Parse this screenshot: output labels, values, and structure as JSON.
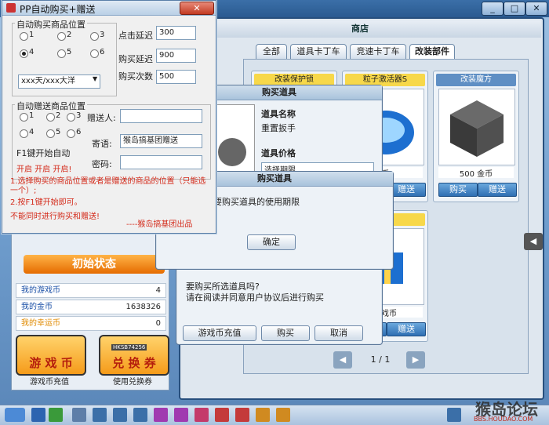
{
  "helper": {
    "title": "PP自动购买+赠送",
    "close": "✕",
    "buy_group": "自动购买商品位置",
    "buy_radios": [
      "1",
      "2",
      "3",
      "4",
      "5",
      "6"
    ],
    "duration_value": "xxx天/xxx大洋",
    "click_delay_label": "点击延迟",
    "click_delay_value": "300",
    "buy_delay_label": "购买延迟",
    "buy_delay_value": "900",
    "buy_count_label": "购买次数",
    "buy_count_value": "500",
    "gift_group": "自动赠送商品位置",
    "gift_radios": [
      "1",
      "2",
      "3",
      "4",
      "5",
      "6"
    ],
    "giver_label": "赠送人:",
    "giver_value": "",
    "message_label": "寄语:",
    "message_value": "猴岛搞基团赠送",
    "password_label": "密码:",
    "password_value": "",
    "f1_text": "F1键开始自动",
    "start_text": "开启 开启 开启!",
    "note1": "1.选择购买的商品位置或者是赠送的商品的位置（只能选一个）;",
    "note2": "2.按F1键开始即可。",
    "note3": "不能同时进行购买和赠送!",
    "credit": "----猴岛搞基团出品"
  },
  "shop": {
    "title": "商店",
    "tabs": [
      "全部",
      "道具卡丁车",
      "竞速卡丁车",
      "改装部件"
    ],
    "cards": [
      {
        "title": "改装保护锁",
        "price": "",
        "buy": "购买",
        "gift": "赠送"
      },
      {
        "title": "粒子激活器S",
        "price": "币",
        "buy": "购买",
        "gift": "赠送"
      },
      {
        "title": "改装魔方",
        "price": "500 金币",
        "buy": "购买",
        "gift": "赠送"
      },
      {
        "title": "礼包",
        "price": "游戏币",
        "buy": "购买",
        "gift": "赠送"
      }
    ],
    "page": "1 / 1"
  },
  "buy_dialog": {
    "title": "购买道具",
    "name_label": "道具名称",
    "name_value": "重置扳手",
    "price_label": "道具价格",
    "price_select": "选择期限",
    "confirm_text1": "要购买所选道具吗?",
    "confirm_text2": "请在阅读并同意用户协议后进行购买",
    "btn_recharge": "游戏币充值",
    "btn_buy": "购买",
    "btn_cancel": "取消"
  },
  "alert_dialog": {
    "title": "购买道具",
    "message": "请选择要购买道具的使用期限",
    "ok": "确定"
  },
  "side": {
    "init_status": "初始状态",
    "stats": [
      {
        "label": "我的游戏币",
        "value": "4"
      },
      {
        "label": "我的金币",
        "value": "1638326"
      },
      {
        "label": "我的幸运币",
        "value": "0"
      }
    ],
    "btn_coin": "游 戏 币",
    "btn_coin_cap": "游戏币充值",
    "btn_coupon": "兑 换 券",
    "btn_coupon_cap": "使用兑换券",
    "coupon_code": "HKSB74256"
  },
  "watermark": "猴岛论坛",
  "watermark_url": "BBS.HOUDAO.COM"
}
